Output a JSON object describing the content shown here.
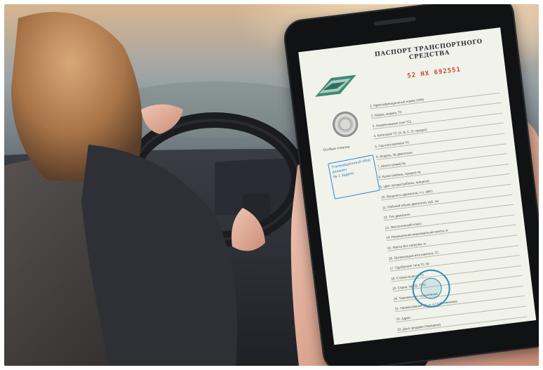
{
  "scene": {
    "description_kind": "photo",
    "colors": {
      "sky_glow": "#e9c9a4",
      "interior_dark": "#2b2d34",
      "phone_body": "#111214",
      "skin": "#e8b8a4",
      "document_paper": "#f1f2ea",
      "stamp_blue": "#2f86c9",
      "number_red": "#c24a36"
    }
  },
  "document": {
    "title": "ПАСПОРТ ТРАНСПОРТНОГО СРЕДСТВА",
    "number": "52 НХ 692551",
    "stamp_lines": [
      "Утилизационный сбор",
      "уплачен",
      "№ 1 задачи"
    ],
    "seal_caption": "Особые отметки",
    "rows": [
      "1. Идентификационный номер (VIN)",
      "2. Марка, модель ТС",
      "3. Наименование (тип ТС)",
      "4. Категория ТС (A, B, C, D, прицеп)",
      "5. Год изготовления ТС",
      "6. Модель, № двигателя",
      "7. Шасси (рама) №",
      "8. Кузов (кабина, прицеп) №",
      "9. Цвет кузова (кабины, прицепа)",
      "10. Мощность двигателя, л.с. (кВт)",
      "11. Рабочий объем двигателя, куб. см",
      "12. Тип двигателя",
      "13. Экологический класс",
      "14. Разрешенная максимальная масса, кг",
      "15. Масса без нагрузки, кг",
      "16. Организация-изготовитель ТС",
      "17. Одобрение типа ТС №",
      "18. Страна вывоза ТС",
      "19. Серия, № ТД, ТПО",
      "20. Таможенные ограничения"
    ],
    "lower_rows": [
      "21. Наименование (ф. и. о.) собственника",
      "22. Адрес",
      "23. Дата продажи (передачи)",
      "24. Документ на право собственности"
    ]
  }
}
